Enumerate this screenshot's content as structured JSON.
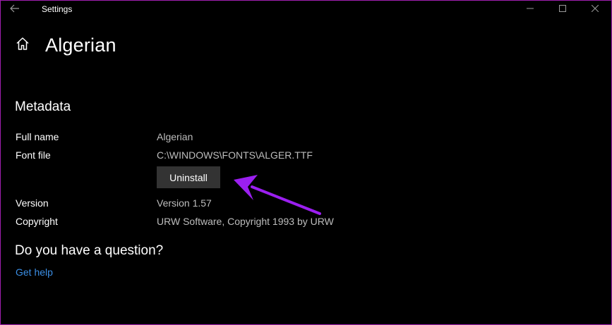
{
  "titlebar": {
    "title": "Settings",
    "back_icon": "back-arrow-icon",
    "minimize_icon": "minimize-icon",
    "maximize_icon": "maximize-icon",
    "close_icon": "close-icon"
  },
  "header": {
    "home_icon": "home-icon",
    "title": "Algerian"
  },
  "metadata": {
    "heading": "Metadata",
    "full_name_label": "Full name",
    "full_name_value": "Algerian",
    "font_file_label": "Font file",
    "font_file_value": "C:\\WINDOWS\\FONTS\\ALGER.TTF",
    "uninstall_label": "Uninstall",
    "version_label": "Version",
    "version_value": "Version 1.57",
    "copyright_label": "Copyright",
    "copyright_value": "URW Software, Copyright 1993 by URW"
  },
  "help": {
    "heading": "Do you have a question?",
    "link_label": "Get help"
  },
  "annotation": {
    "arrow_color": "#9b1ff0"
  },
  "colors": {
    "background": "#000000",
    "border": "#a020b0",
    "link": "#3b8fe6",
    "button": "#333333",
    "value_text": "#bdbdbd"
  }
}
